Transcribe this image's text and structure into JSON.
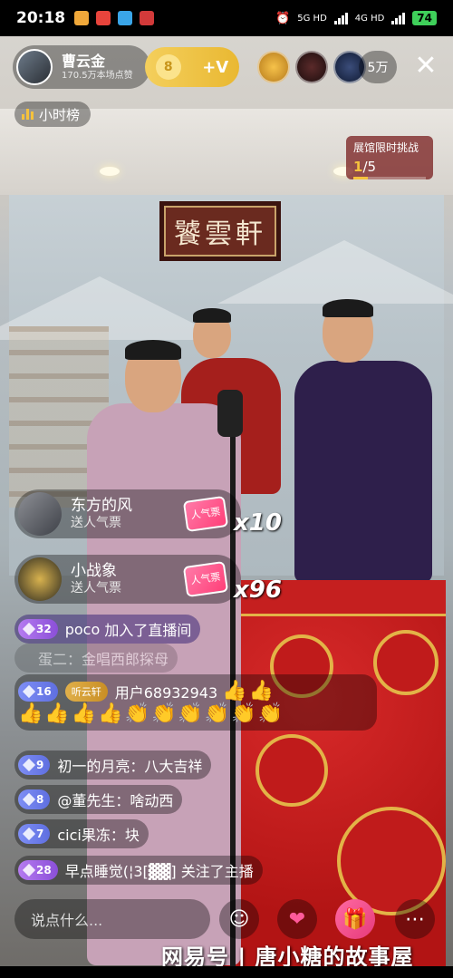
{
  "status_bar": {
    "time": "20:18",
    "network_1": "5G HD",
    "network_2": "4G HD",
    "battery": "74"
  },
  "host": {
    "name": "曹云金",
    "likes": "170.5万本场点赞"
  },
  "follow_button": {
    "coin_level": "8",
    "label": "+V"
  },
  "viewer_count": "5万",
  "hour_rank_label": "小时榜",
  "challenge": {
    "title": "展馆限时挑战",
    "current": "1",
    "total": "/5"
  },
  "plaque_text": "饕雲軒",
  "gifts": [
    {
      "name": "东方的风",
      "action": "送人气票",
      "combo": "x10",
      "gift_label": "人气票"
    },
    {
      "name": "小战象",
      "action": "送人气票",
      "combo": "x96",
      "gift_label": "人气票"
    }
  ],
  "chat": [
    {
      "level": "32",
      "user": "poco",
      "message": "加入了直播间"
    },
    {
      "level": "",
      "user": "",
      "message": "蛋二：金唱西郎探母"
    },
    {
      "level": "16",
      "fan": "听云轩",
      "user": "用户68932943",
      "message": "👍👍",
      "emoji_line": "👍👍👍👍👏👏👏👏👏👏"
    },
    {
      "level": "9",
      "user": "初一的月亮",
      "message": "八大吉祥"
    },
    {
      "level": "8",
      "user": "@董先生",
      "message": "啥动西"
    },
    {
      "level": "7",
      "user": "cici果冻",
      "message": "块"
    },
    {
      "level": "28",
      "user": "早点睡觉(¦3[▓▓]",
      "message": "关注了主播"
    }
  ],
  "input_placeholder": "说点什么...",
  "watermark": "网易号 | 唐小糖的故事屋"
}
